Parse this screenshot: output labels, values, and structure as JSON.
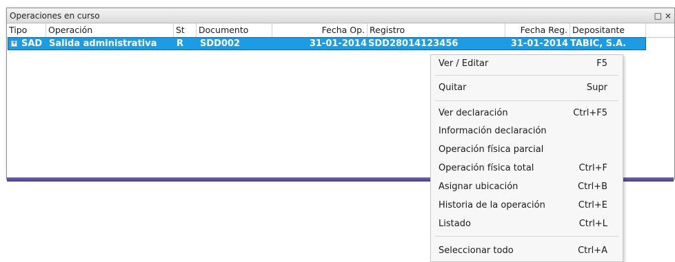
{
  "panel": {
    "title": "Operaciones en curso",
    "controls": {
      "restore_glyph": "□",
      "close_glyph": "×"
    }
  },
  "table": {
    "columns": [
      "Tipo",
      "Operación",
      "St",
      "Documento",
      "Fecha Op.",
      "Registro",
      "Fecha Reg.",
      "Depositante"
    ],
    "rows": [
      {
        "expander": "+",
        "tipo": "SAD",
        "operacion": "Salida administrativa",
        "st": "R",
        "documento": "SDD002",
        "fecha_op": "31-01-2014",
        "registro": "SDD28014123456",
        "fecha_reg": "31-01-2014",
        "depositante": "TABIC, S.A."
      }
    ],
    "selection_color": "#1b9ce5"
  },
  "context_menu": {
    "items": [
      {
        "label": "Ver / Editar",
        "shortcut": "F5"
      },
      {
        "label": "Quitar",
        "shortcut": "Supr"
      },
      {
        "label": "Ver declaración",
        "shortcut": "Ctrl+F5"
      },
      {
        "label": "Información declaración",
        "shortcut": ""
      },
      {
        "label": "Operación física parcial",
        "shortcut": ""
      },
      {
        "label": "Operación física total",
        "shortcut": "Ctrl+F"
      },
      {
        "label": "Asignar ubicación",
        "shortcut": "Ctrl+B"
      },
      {
        "label": "Historia de la operación",
        "shortcut": "Ctrl+E"
      },
      {
        "label": "Listado",
        "shortcut": "Ctrl+L"
      },
      {
        "label": "Seleccionar todo",
        "shortcut": "Ctrl+A"
      }
    ]
  }
}
